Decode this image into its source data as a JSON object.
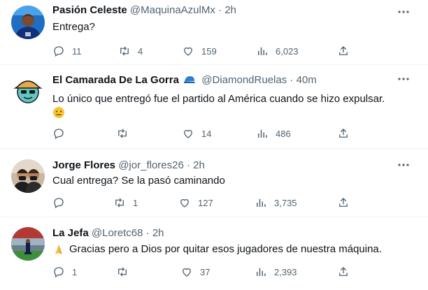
{
  "tweets": [
    {
      "name": "Pasión Celeste",
      "handle": "@MaquinaAzulMx",
      "dot": "·",
      "time": "2h",
      "text": "Entrega?",
      "replies": "11",
      "retweets": "4",
      "likes": "159",
      "views": "6,023"
    },
    {
      "name": "El Camarada De La Gorra",
      "badge_icon": "blue-cap-emoji",
      "handle": "@DiamondRuelas",
      "dot": "·",
      "time": "40m",
      "text": "Lo único que entregó fue el partido al América cuando se hizo expulsar.",
      "emoji": "neutral-face-emoji",
      "replies": "",
      "retweets": "",
      "likes": "14",
      "views": "486"
    },
    {
      "name": "Jorge Flores",
      "handle": "@jor_flores26",
      "dot": "·",
      "time": "2h",
      "text": "Cual entrega? Se la pasó caminando",
      "replies": "",
      "retweets": "1",
      "likes": "127",
      "views": "3,735"
    },
    {
      "name": "La Jefa",
      "handle": "@Loretc68",
      "dot": "·",
      "time": "2h",
      "emoji": "folded-hands-emoji",
      "text": "Gracias pero a Dios por quitar esos jugadores de nuestra máquina.",
      "replies": "1",
      "retweets": "",
      "likes": "37",
      "views": "2,393"
    }
  ],
  "colors": {
    "text": "#0f1419",
    "secondary": "#536471",
    "divider": "#eff3f4"
  }
}
